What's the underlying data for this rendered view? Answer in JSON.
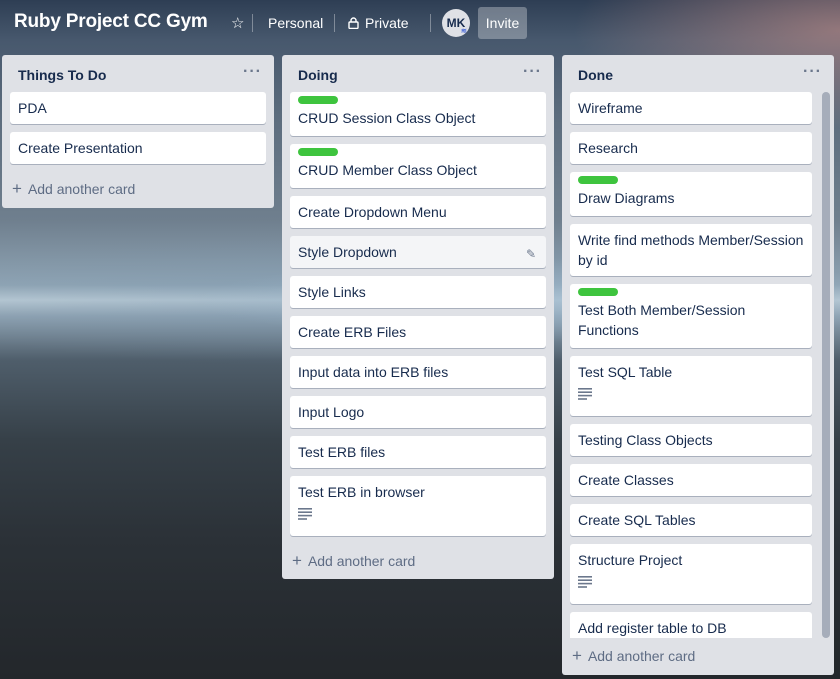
{
  "header": {
    "title": "Ruby Project CC Gym",
    "star_icon": "star-icon",
    "personal_label": "Personal",
    "private_label": "Private",
    "avatar_initials": "MK",
    "invite_label": "Invite"
  },
  "colors": {
    "list_bg": "#dfe1e6",
    "label_green": "#3ec43e",
    "text": "#172b4d"
  },
  "lists": [
    {
      "title": "Things To Do",
      "cards": [
        {
          "text": "PDA"
        },
        {
          "text": "Create Presentation"
        }
      ],
      "add_label": "Add another card"
    },
    {
      "title": "Doing",
      "cards": [
        {
          "text": "CRUD Session Class Object",
          "label": "green"
        },
        {
          "text": "CRUD Member Class Object",
          "label": "green"
        },
        {
          "text": "Create Dropdown Menu"
        },
        {
          "text": "Style Dropdown",
          "hover": true,
          "edit_icon": "pencil-icon"
        },
        {
          "text": "Style Links"
        },
        {
          "text": "Create ERB Files"
        },
        {
          "text": "Input data into ERB files"
        },
        {
          "text": "Input Logo"
        },
        {
          "text": "Test ERB files"
        },
        {
          "text": "Test ERB in browser",
          "description_icon": "description-icon"
        }
      ],
      "add_label": "Add another card"
    },
    {
      "title": "Done",
      "cards": [
        {
          "text": "Wireframe"
        },
        {
          "text": "Research"
        },
        {
          "text": "Draw Diagrams",
          "label": "green"
        },
        {
          "text": "Write find methods Member/Session by id"
        },
        {
          "text": "Test Both Member/Session Functions",
          "label": "green"
        },
        {
          "text": "Test SQL Table",
          "description_icon": "description-icon"
        },
        {
          "text": "Testing Class Objects"
        },
        {
          "text": "Create Classes"
        },
        {
          "text": "Create SQL Tables"
        },
        {
          "text": "Structure Project",
          "description_icon": "description-icon"
        },
        {
          "text": "Add register table to DB"
        }
      ],
      "add_label": "Add another card"
    }
  ]
}
